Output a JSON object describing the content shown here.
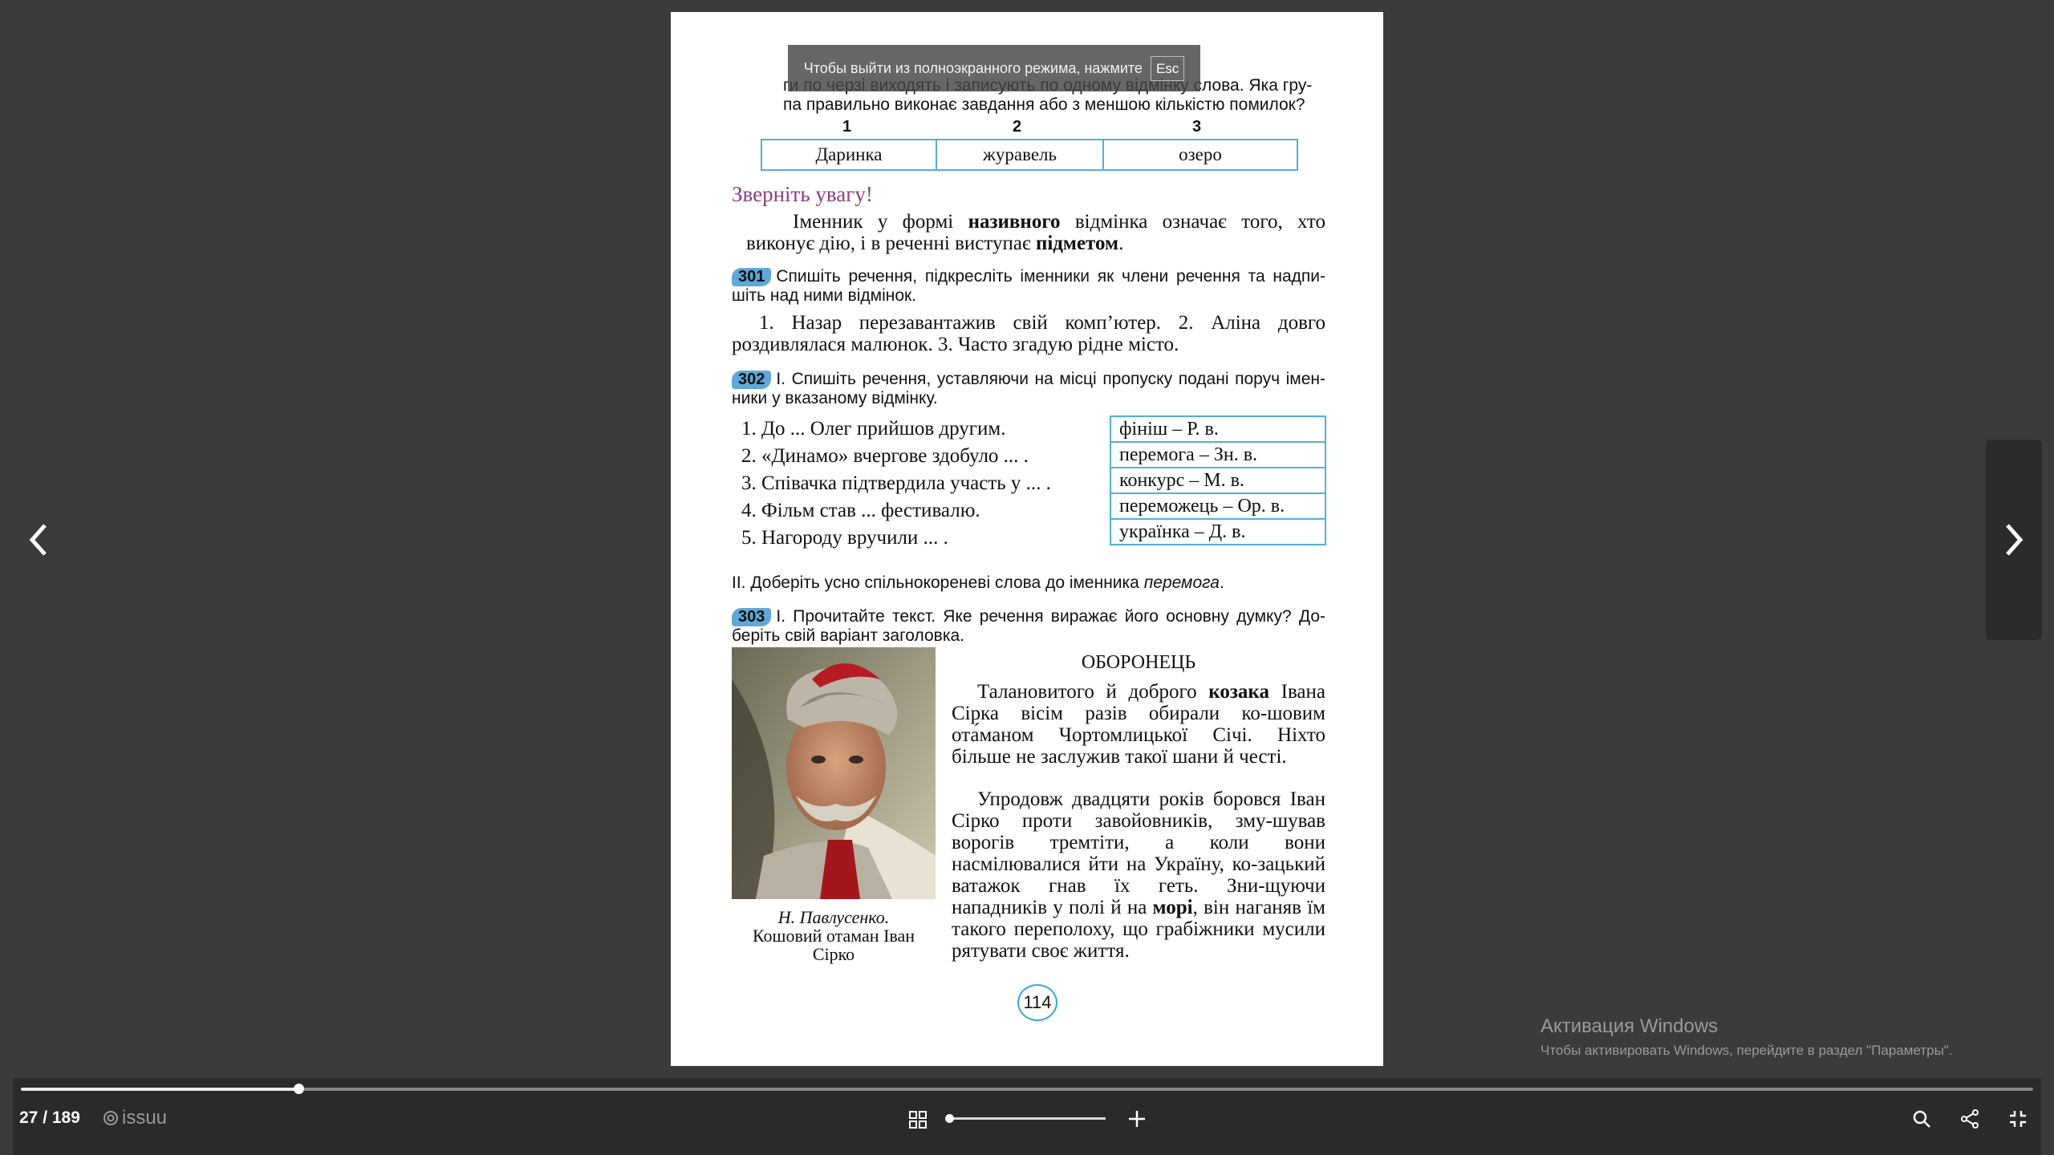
{
  "toast": {
    "text": "Чтобы выйти из полноэкранного режима, нажмите",
    "key": "Esc"
  },
  "top": {
    "line1": "ги по черзі виходять і записують по одному відмінку слова. Яка гру-",
    "line2": "па правильно виконає завдання або з меншою кількістю помилок?",
    "col_numbers": [
      "1",
      "2",
      "3"
    ],
    "cells": [
      "Даринка",
      "журавель",
      "озеро"
    ]
  },
  "attention": {
    "heading": "Зверніть увагу!",
    "p_start": "Іменник у формі ",
    "p_bold1": "називного",
    "p_mid": " відмінка означає того, хто виконує дію, і в реченні виступає ",
    "p_bold2": "підметом",
    "p_end": "."
  },
  "ex301": {
    "number": "301",
    "instruction": "Спишіть речення, підкресліть іменники як члени речення та надпи-шіть над ними відмінок.",
    "text": "1. Назар перезавантажив свій комп’ютер. 2. Аліна довго роздивлялася малюнок. 3. Часто згадую рідне місто."
  },
  "ex302": {
    "number": "302",
    "instruction": "І. Спишіть речення, уставляючи на місці пропуску подані поруч імен-ники у вказаному відмінку.",
    "sentences": [
      "1. До ... Олег прийшов другим.",
      "2. «Динамо» вчергове здобуло ... .",
      "3. Співачка підтвердила участь у ... .",
      "4. Фільм став ... фестивалю.",
      "5. Нагороду вручили ... ."
    ],
    "words": [
      "фініш – Р. в.",
      "перемога – Зн. в.",
      "конкурс – М. в.",
      "переможець – Ор. в.",
      "українка – Д. в."
    ],
    "part2_start": "ІІ. Доберіть усно спільнокореневі слова до іменника ",
    "part2_italic": "перемога",
    "part2_end": "."
  },
  "ex303": {
    "number": "303",
    "instruction": "І. Прочитайте текст. Яке речення виражає його основну думку? До-беріть свій варіант заголовка.",
    "title": "ОБОРОНЕЦЬ",
    "p1_start": "Талановитого й доброго ",
    "p1_bold": "козака",
    "p1_end": " Івана Сірка вісім разів обирали ко-шовим ота́маном Чортомлицької Січі. Ніхто більше не заслужив такої шани й честі.",
    "p2_start": "Упродовж двадцяти років боровся Іван Сірко проти завойовників, зму-шував ворогів тремтіти, а коли вони насмілювалися йти на Україну, ко-зацький ватажок гнав їх геть. Зни-щуючи нападників у полі й на ",
    "p2_bold": "морі",
    "p2_end": ", він наганяв їм такого переполоху, що грабіжники мусили рятувати своє життя.",
    "caption_author": "Н. Павлусенко.",
    "caption_title": "Кошовий отаман Іван Сірко"
  },
  "page_number": "114",
  "viewer": {
    "page_counter": "27 / 189",
    "logo": "issuu",
    "progress_fraction": 0.138,
    "zoom_fraction": 0.0
  },
  "activation": {
    "title": "Активация Windows",
    "subtitle": "Чтобы активировать Windows, перейдите в раздел \"Параметры\"."
  },
  "colors": {
    "background": "#3b3b3b",
    "bar": "#2a2a2a",
    "table_border": "#52b0d8",
    "badge": "#5fa8d8",
    "heading": "#8a3f86"
  }
}
